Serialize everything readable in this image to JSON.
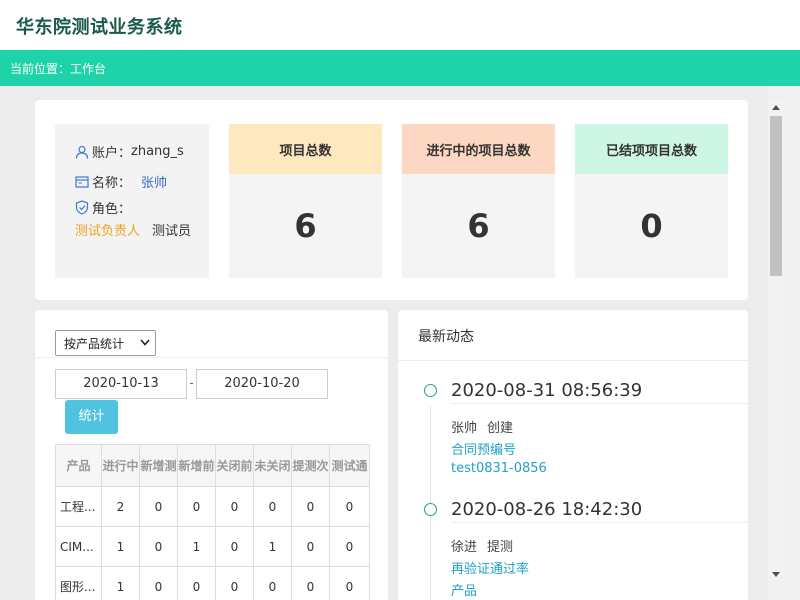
{
  "app": {
    "title": "华东院测试业务系统"
  },
  "breadcrumb": "当前位置：工作台",
  "user": {
    "account_label": "账户：",
    "account_value": "zhang_s",
    "name_label": "名称：",
    "name_value": "张帅",
    "role_label": "角色：",
    "roles": [
      "测试负责人",
      "测试员"
    ]
  },
  "stats": [
    {
      "label": "项目总数",
      "value": "6"
    },
    {
      "label": "进行中的项目总数",
      "value": "6"
    },
    {
      "label": "已结项项目总数",
      "value": "0"
    }
  ],
  "filter": {
    "select_value": "按产品统计",
    "date_start": "2020-10-13",
    "date_separator": "-",
    "date_end": "2020-10-20",
    "button_label": "统计"
  },
  "table": {
    "headers": [
      "产品",
      "进行中",
      "新增测",
      "新增前",
      "关闭前",
      "未关闭",
      "提测次",
      "测试通"
    ],
    "rows": [
      [
        "工程...",
        "2",
        "0",
        "0",
        "0",
        "0",
        "0",
        "0"
      ],
      [
        "CIM...",
        "1",
        "0",
        "1",
        "0",
        "1",
        "0",
        "0"
      ],
      [
        "图形...",
        "1",
        "0",
        "0",
        "0",
        "0",
        "0",
        "0"
      ]
    ]
  },
  "activity": {
    "title": "最新动态",
    "items": [
      {
        "time": "2020-08-31 08:56:39",
        "user": "张帅",
        "action": "创建",
        "links": [
          "合同预编号",
          "test0831-0856"
        ]
      },
      {
        "time": "2020-08-26 18:42:30",
        "user": "徐进",
        "action": "提测",
        "links": [
          "再验证通过率",
          "产品"
        ]
      }
    ]
  },
  "colors": {
    "brand_bar": "#1fd3a8",
    "title_text": "#1a5a4a",
    "stat1_head": "#fde8c0",
    "stat2_head": "#fcd7c2",
    "stat3_head": "#cdf6e4",
    "button": "#4fc3e0",
    "link": "#21a0c8",
    "role_highlight": "#f0a020"
  }
}
